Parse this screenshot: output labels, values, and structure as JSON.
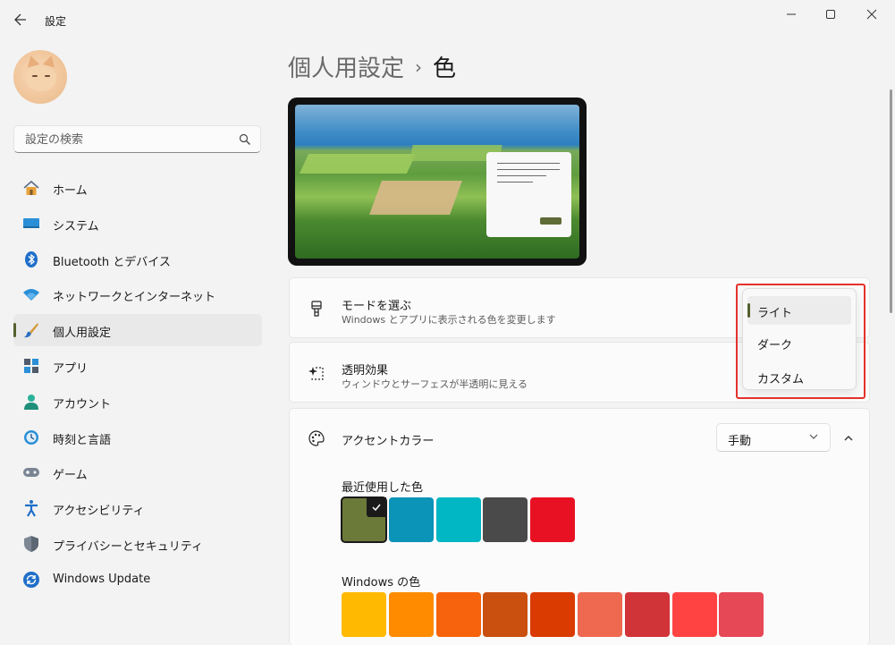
{
  "window": {
    "title": "設定"
  },
  "search": {
    "placeholder": "設定の検索"
  },
  "sidebar": {
    "items": [
      {
        "label": "ホーム",
        "icon": "home-icon"
      },
      {
        "label": "システム",
        "icon": "system-icon"
      },
      {
        "label": "Bluetooth とデバイス",
        "icon": "bluetooth-icon"
      },
      {
        "label": "ネットワークとインターネット",
        "icon": "wifi-icon"
      },
      {
        "label": "個人用設定",
        "icon": "brush-icon",
        "active": true
      },
      {
        "label": "アプリ",
        "icon": "apps-icon"
      },
      {
        "label": "アカウント",
        "icon": "account-icon"
      },
      {
        "label": "時刻と言語",
        "icon": "time-language-icon"
      },
      {
        "label": "ゲーム",
        "icon": "gamepad-icon"
      },
      {
        "label": "アクセシビリティ",
        "icon": "accessibility-icon"
      },
      {
        "label": "プライバシーとセキュリティ",
        "icon": "shield-icon"
      },
      {
        "label": "Windows Update",
        "icon": "update-icon"
      }
    ]
  },
  "breadcrumb": {
    "parent": "個人用設定",
    "separator": "›",
    "current": "色"
  },
  "mode": {
    "title": "モードを選ぶ",
    "subtitle": "Windows とアプリに表示される色を変更します"
  },
  "transparency": {
    "title": "透明効果",
    "subtitle": "ウィンドウとサーフェスが半透明に見える"
  },
  "accent": {
    "title": "アクセントカラー",
    "dropdown_value": "手動"
  },
  "mode_popup": {
    "options": [
      "ライト",
      "ダーク",
      "カスタム"
    ],
    "selected": "ライト"
  },
  "recent_colors": {
    "label": "最近使用した色",
    "colors": [
      "#6b7a39",
      "#0b93b8",
      "#00b7c3",
      "#4a4a4a",
      "#e81123"
    ],
    "selected_index": 0
  },
  "windows_colors": {
    "label": "Windows の色",
    "colors": [
      "#ffb900",
      "#ff8c00",
      "#f7630c",
      "#ca5010",
      "#da3b01",
      "#ef6950",
      "#d13438",
      "#ff4343",
      "#e74856"
    ]
  },
  "colors": {
    "accent": "#55612d",
    "highlight_box": "#e5322b"
  }
}
